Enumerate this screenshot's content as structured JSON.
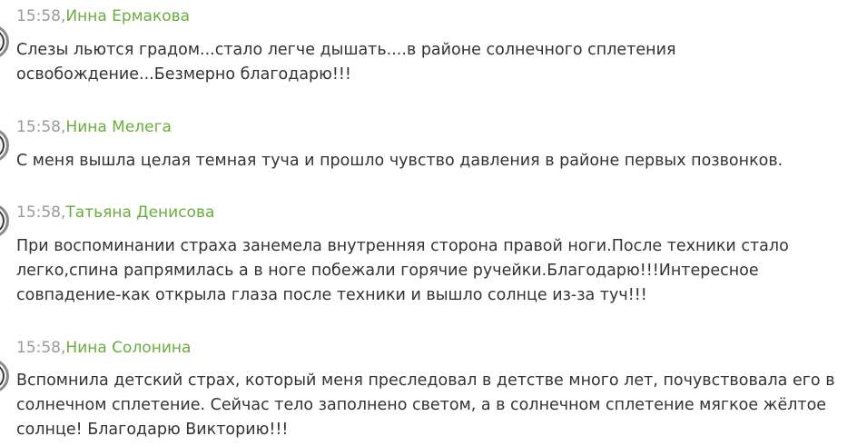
{
  "comments": [
    {
      "time": "15:58,",
      "author": "Инна Ермакова",
      "text": "Слезы льются градом...стало легче дышать....в районе солнечного сплетения освобождение...Безмерно благодарю!!!"
    },
    {
      "time": "15:58,",
      "author": "Нина Мелега",
      "text": "С меня вышла целая темная туча и прошло чувство давления в районе первых позвонков."
    },
    {
      "time": "15:58,",
      "author": "Татьяна Денисова",
      "text": "При воспоминании страха занемела внутренняя сторона правой ноги.После техники стало легко,спина рапрямилась а в ноге побежали горячие ручейки.Благодарю!!!Интересное совпадение-как открыла глаза после техники и вышло солнце из-за туч!!!"
    },
    {
      "time": "15:58,",
      "author": "Нина Солонина",
      "text": "Вспомнила детский страх, который меня преследовал в детстве много лет, почувствовала его в солнечном сплетение. Сейчас тело заполнено светом, а в солнечном сплетение мягкое жёлтое солнце! Благодарю Викторию!!!"
    }
  ]
}
